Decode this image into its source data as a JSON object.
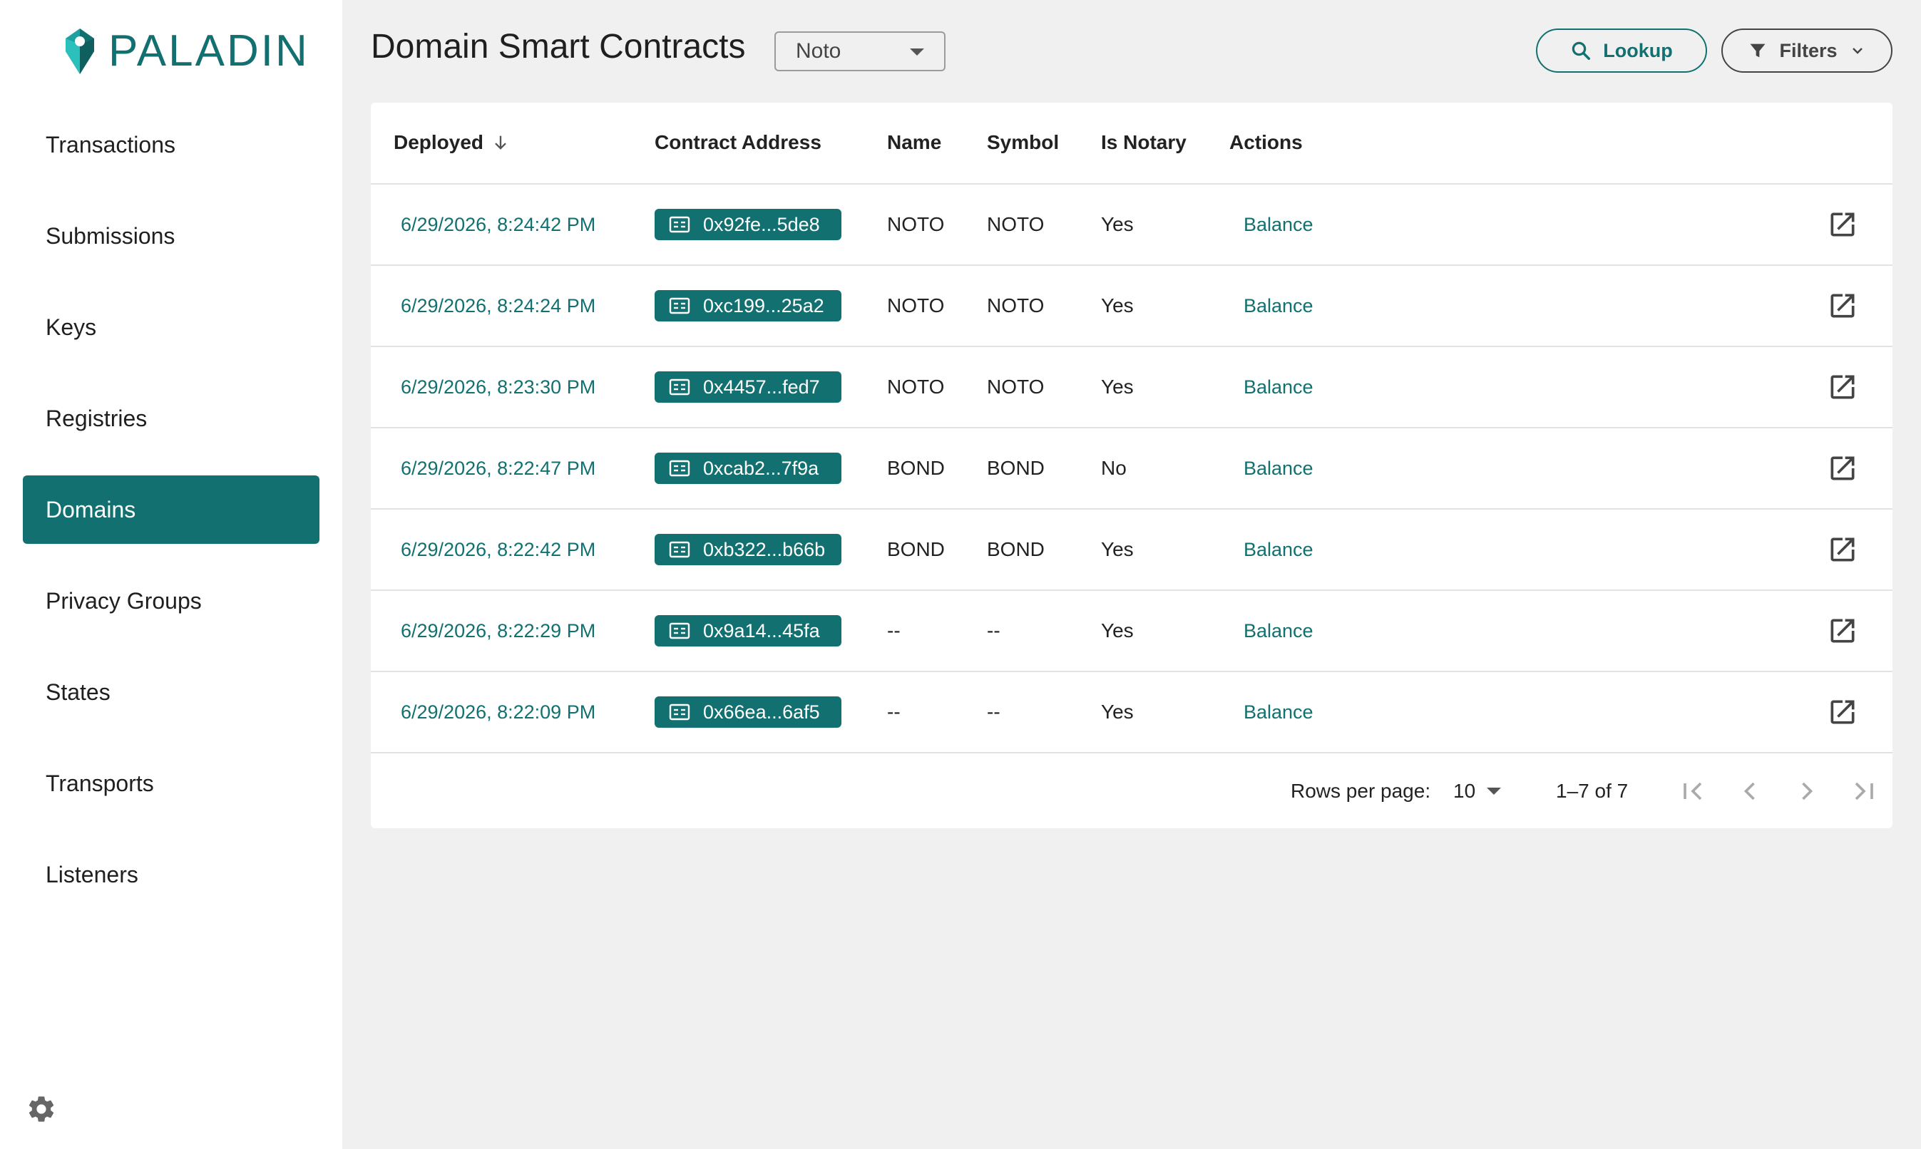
{
  "brand": {
    "name": "PALADIN",
    "accent_color": "#127070"
  },
  "sidebar": {
    "items": [
      {
        "label": "Transactions",
        "active": false
      },
      {
        "label": "Submissions",
        "active": false
      },
      {
        "label": "Keys",
        "active": false
      },
      {
        "label": "Registries",
        "active": false
      },
      {
        "label": "Domains",
        "active": true
      },
      {
        "label": "Privacy Groups",
        "active": false
      },
      {
        "label": "States",
        "active": false
      },
      {
        "label": "Transports",
        "active": false
      },
      {
        "label": "Listeners",
        "active": false
      }
    ],
    "settings_icon": "gear-icon"
  },
  "header": {
    "title": "Domain Smart Contracts",
    "domain_select": {
      "value": "Noto"
    },
    "lookup_label": "Lookup",
    "filters_label": "Filters"
  },
  "table": {
    "columns": {
      "deployed": "Deployed",
      "address": "Contract Address",
      "name": "Name",
      "symbol": "Symbol",
      "is_notary": "Is Notary",
      "actions": "Actions"
    },
    "sort": {
      "column": "Deployed",
      "direction": "descending"
    },
    "rows": [
      {
        "deployed": "6/29/2026, 8:24:42 PM",
        "address": "0x92fe...5de8",
        "name": "NOTO",
        "symbol": "NOTO",
        "is_notary": "Yes",
        "action": "Balance"
      },
      {
        "deployed": "6/29/2026, 8:24:24 PM",
        "address": "0xc199...25a2",
        "name": "NOTO",
        "symbol": "NOTO",
        "is_notary": "Yes",
        "action": "Balance"
      },
      {
        "deployed": "6/29/2026, 8:23:30 PM",
        "address": "0x4457...fed7",
        "name": "NOTO",
        "symbol": "NOTO",
        "is_notary": "Yes",
        "action": "Balance"
      },
      {
        "deployed": "6/29/2026, 8:22:47 PM",
        "address": "0xcab2...7f9a",
        "name": "BOND",
        "symbol": "BOND",
        "is_notary": "No",
        "action": "Balance"
      },
      {
        "deployed": "6/29/2026, 8:22:42 PM",
        "address": "0xb322...b66b",
        "name": "BOND",
        "symbol": "BOND",
        "is_notary": "Yes",
        "action": "Balance"
      },
      {
        "deployed": "6/29/2026, 8:22:29 PM",
        "address": "0x9a14...45fa",
        "name": "--",
        "symbol": "--",
        "is_notary": "Yes",
        "action": "Balance"
      },
      {
        "deployed": "6/29/2026, 8:22:09 PM",
        "address": "0x66ea...6af5",
        "name": "--",
        "symbol": "--",
        "is_notary": "Yes",
        "action": "Balance"
      }
    ]
  },
  "pagination": {
    "rows_per_page_label": "Rows per page:",
    "rows_per_page": "10",
    "range": "1–7 of 7"
  }
}
